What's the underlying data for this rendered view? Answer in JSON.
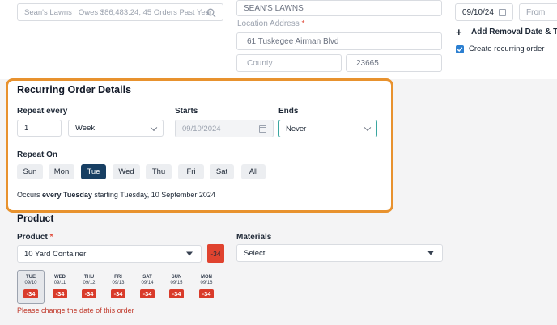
{
  "top": {
    "customer_search_value": "Sean's Lawns",
    "customer_summary": "Owes $86,483.24, 45 Orders Past Year",
    "site_name_value": "SEAN'S LAWNS",
    "location_address_label": "Location Address",
    "address_value": "61 Tuskegee Airman Blvd",
    "county_placeholder": "County",
    "zip_value": "23665",
    "date_value": "09/10/24",
    "from_placeholder": "From",
    "add_removal_label": "Add Removal Date & T",
    "add_removal_icon": "plus-icon",
    "create_recurring_label": "Create recurring order",
    "create_recurring_checked": true
  },
  "recurring": {
    "title": "Recurring Order Details",
    "repeat_every_label": "Repeat every",
    "repeat_every_value": "1",
    "repeat_unit": "Week",
    "starts_label": "Starts",
    "starts_value": "09/10/2024",
    "ends_label": "Ends",
    "ends_value": "Never",
    "repeat_on_label": "Repeat On",
    "days": [
      {
        "label": "Sun",
        "active": false
      },
      {
        "label": "Mon",
        "active": false
      },
      {
        "label": "Tue",
        "active": true
      },
      {
        "label": "Wed",
        "active": false
      },
      {
        "label": "Thu",
        "active": false
      },
      {
        "label": "Fri",
        "active": false
      },
      {
        "label": "Sat",
        "active": false
      },
      {
        "label": "All",
        "active": false
      }
    ],
    "summary_prefix": "Occurs",
    "summary_bold": "every Tuesday",
    "summary_suffix": "starting Tuesday, 10 September 2024",
    "highlight_color": "#e8922e",
    "active_day_color": "#173f63"
  },
  "product": {
    "title": "Product",
    "product_label": "Product",
    "product_value": "10 Yard Container",
    "stock_badge": "-34",
    "materials_label": "Materials",
    "materials_value": "Select",
    "dates": [
      {
        "dow": "TUE",
        "date": "09/10",
        "badge": "-34",
        "selected": true
      },
      {
        "dow": "WED",
        "date": "09/11",
        "badge": "-34",
        "selected": false
      },
      {
        "dow": "THU",
        "date": "09/12",
        "badge": "-34",
        "selected": false
      },
      {
        "dow": "FRI",
        "date": "09/13",
        "badge": "-34",
        "selected": false
      },
      {
        "dow": "SAT",
        "date": "09/14",
        "badge": "-34",
        "selected": false
      },
      {
        "dow": "SUN",
        "date": "09/15",
        "badge": "-34",
        "selected": false
      },
      {
        "dow": "MON",
        "date": "09/16",
        "badge": "-34",
        "selected": false
      }
    ],
    "error_message": "Please change the date of this order",
    "error_color": "#c0392b",
    "badge_color": "#d93b2b"
  }
}
